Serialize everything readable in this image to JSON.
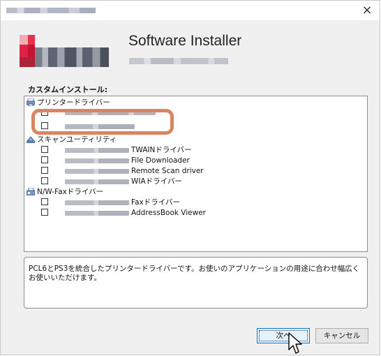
{
  "window": {
    "close_glyph": "×"
  },
  "banner": {
    "title": "Software Installer"
  },
  "section": {
    "title": "カスタムインストール:"
  },
  "groups": [
    {
      "label": "プリンタードライバー",
      "icon": "printer-icon"
    },
    {
      "label": "スキャンユーティリティ",
      "icon": "scanner-icon"
    },
    {
      "label": "N/W-Faxドライバー",
      "icon": "fax-icon"
    }
  ],
  "printer_items": [
    {
      "checked": true,
      "label": ""
    },
    {
      "checked": false,
      "label": ""
    }
  ],
  "scan_items": [
    {
      "checked": false,
      "label": "TWAINドライバー"
    },
    {
      "checked": false,
      "label": "File Downloader"
    },
    {
      "checked": false,
      "label": "Remote Scan driver"
    },
    {
      "checked": false,
      "label": "WIAドライバー"
    }
  ],
  "fax_items": [
    {
      "checked": false,
      "label": "Faxドライバー"
    },
    {
      "checked": false,
      "label": "AddressBook Viewer"
    }
  ],
  "description": "PCL6とPS3を統合したプリンタードライバーです。お使いのアプリケーションの用途に合わせ幅広くお使いいただけます。",
  "buttons": {
    "next": "次へ",
    "cancel": "キャンセル"
  },
  "colors": {
    "highlight": "#d98560",
    "accent": "#0078d7"
  }
}
